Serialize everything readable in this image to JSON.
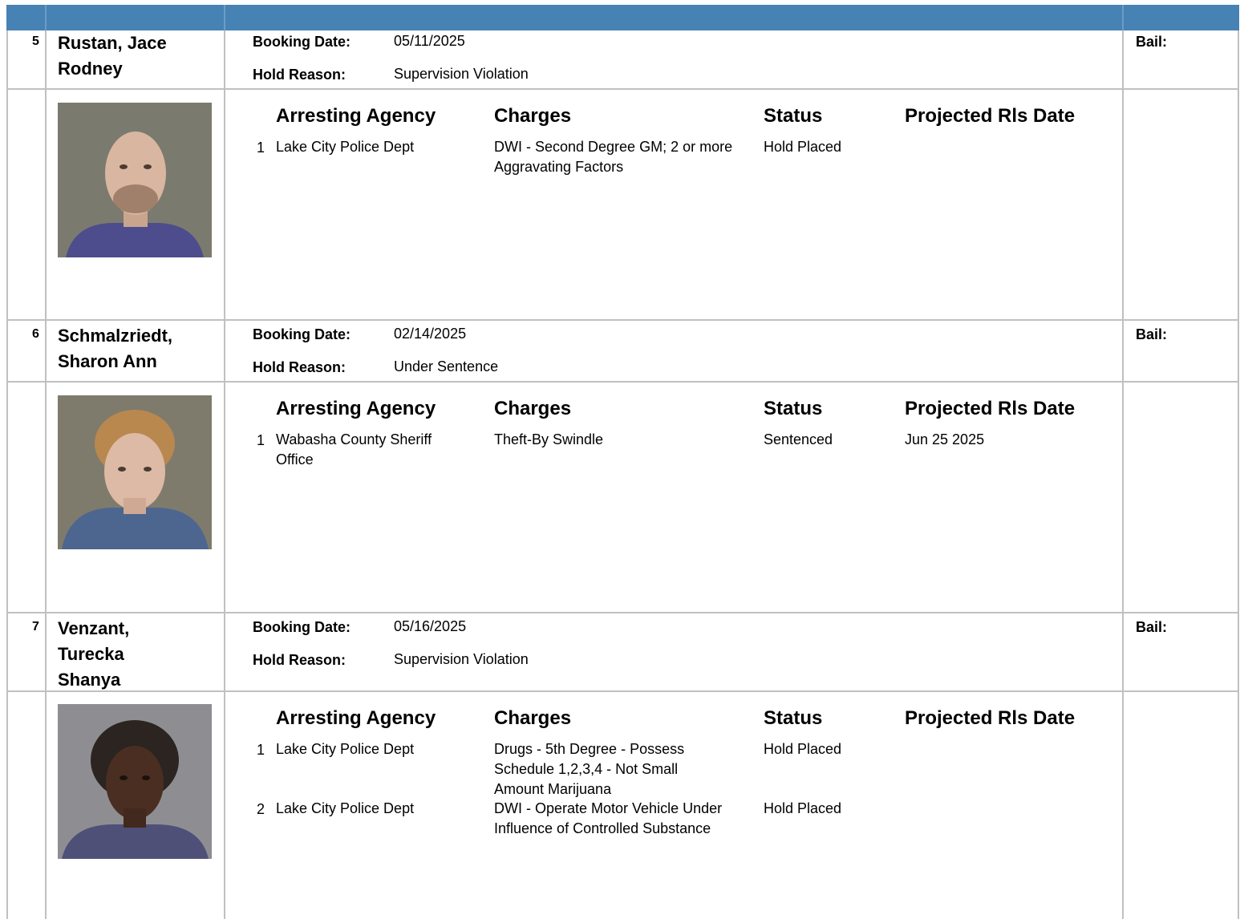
{
  "labels": {
    "booking_date": "Booking Date:",
    "hold_reason": "Hold Reason:",
    "bail": "Bail:"
  },
  "charge_headers": {
    "agency": "Arresting Agency",
    "charges": "Charges",
    "status": "Status",
    "release": "Projected Rls Date"
  },
  "colors": {
    "header_bar": "#4682b4",
    "grid": "#c0c0c0"
  },
  "inmates": [
    {
      "number": "5",
      "name": "Rustan, Jace Rodney",
      "booking_date": "05/11/2025",
      "hold_reason": "Supervision Violation",
      "bail": "",
      "photo": "booking-photo",
      "charges": [
        {
          "index": "1",
          "agency": "Lake City Police Dept",
          "charge": "DWI - Second Degree GM; 2 or more Aggravating Factors",
          "status": "Hold Placed",
          "release": ""
        }
      ]
    },
    {
      "number": "6",
      "name": "Schmalzriedt, Sharon Ann",
      "booking_date": "02/14/2025",
      "hold_reason": "Under Sentence",
      "bail": "",
      "photo": "booking-photo",
      "charges": [
        {
          "index": "1",
          "agency": "Wabasha County Sheriff Office",
          "charge": "Theft-By Swindle",
          "status": "Sentenced",
          "release": "Jun 25 2025"
        }
      ]
    },
    {
      "number": "7",
      "name": "Venzant, Turecka Shanya",
      "booking_date": "05/16/2025",
      "hold_reason": "Supervision Violation",
      "bail": "",
      "photo": "booking-photo",
      "charges": [
        {
          "index": "1",
          "agency": "Lake City Police Dept",
          "charge": "Drugs - 5th Degree - Possess Schedule 1,2,3,4 - Not Small Amount Marijuana",
          "status": "Hold Placed",
          "release": ""
        },
        {
          "index": "2",
          "agency": "Lake City Police Dept",
          "charge": "DWI - Operate Motor Vehicle Under Influence of Controlled Substance",
          "status": "Hold Placed",
          "release": ""
        }
      ]
    }
  ]
}
